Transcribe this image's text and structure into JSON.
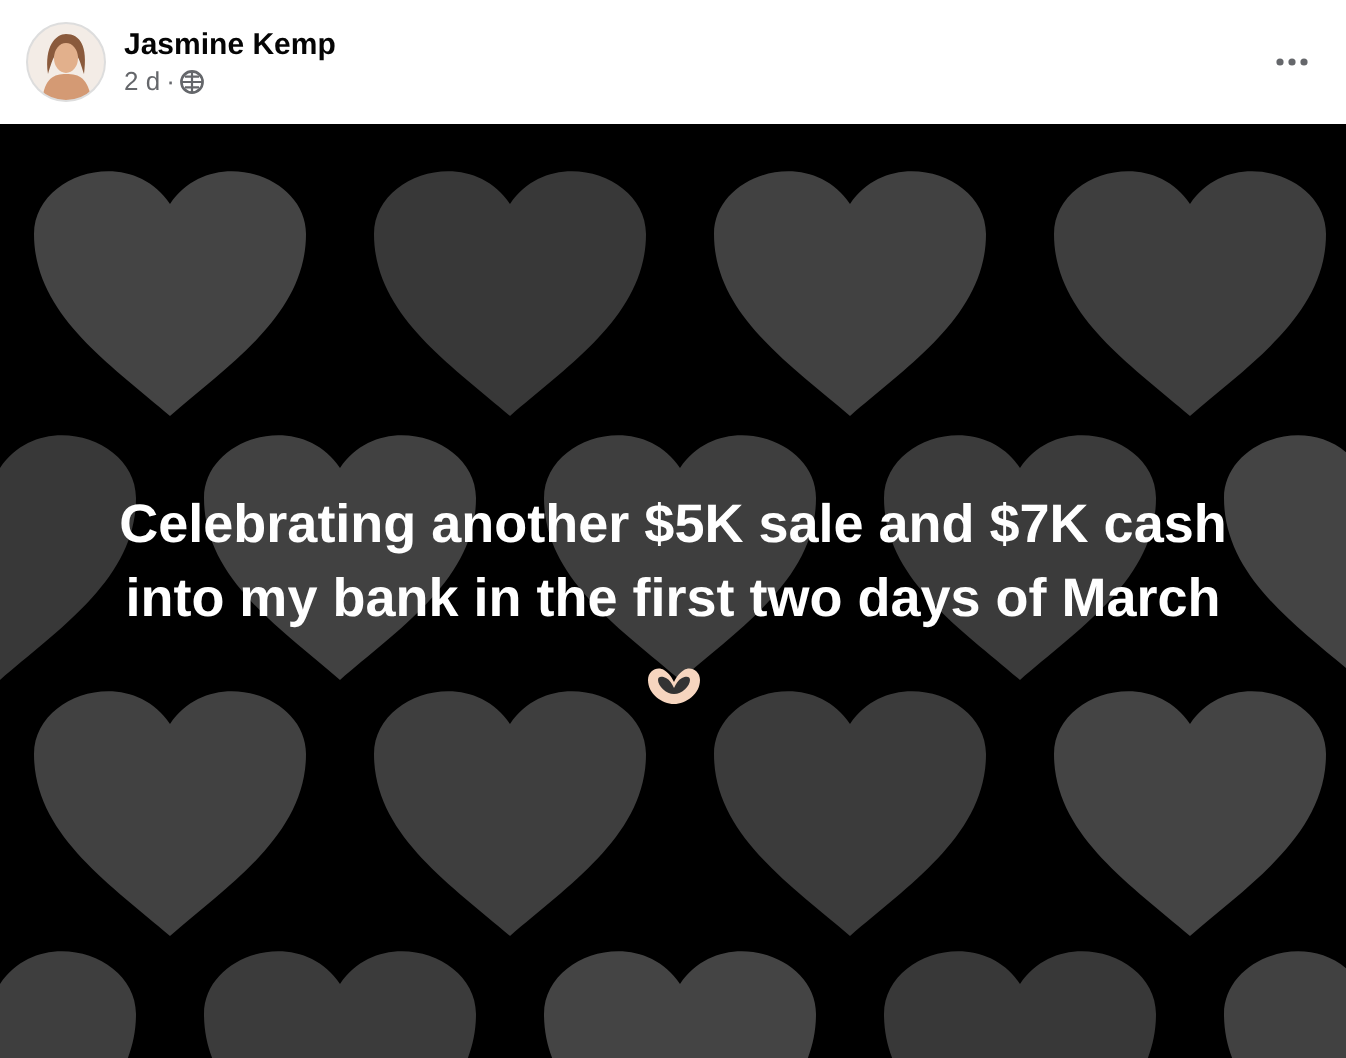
{
  "post": {
    "author": "Jasmine Kemp",
    "time": "2 d",
    "separator": "·",
    "caption_lines": [
      "Celebrating another $5K sale and $7K cash",
      "into my bank in the first two days of March"
    ]
  }
}
